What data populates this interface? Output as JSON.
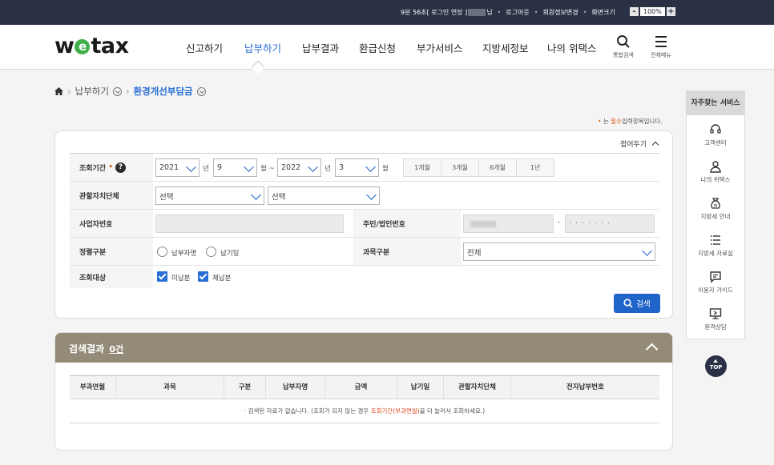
{
  "topbar": {
    "session_prefix": "9분 56초[ 로그인 연장 ]",
    "session_suffix": "님",
    "logout": "로그아웃",
    "member_edit": "회원정보변경",
    "screen_size": "화면크기",
    "zoom_minus": "-",
    "zoom_value": "100%",
    "zoom_plus": "+"
  },
  "header": {
    "logo_pre": "w",
    "logo_e": "e",
    "logo_post": "tax",
    "nav": [
      "신고하기",
      "납부하기",
      "납부결과",
      "환급신청",
      "부가서비스",
      "지방세정보",
      "나의 위택스"
    ],
    "active_nav": "납부하기",
    "search_label": "통합검색",
    "menu_label": "전체메뉴"
  },
  "breadcrumb": {
    "level1": "납부하기",
    "current": "환경개선부담금"
  },
  "note": {
    "bullet": "•",
    "prefix": "는",
    "required": "필수",
    "suffix": "입력항목입니다."
  },
  "form": {
    "collapse_label": "접어두기",
    "period_label": "조회기간",
    "period_required_mark": "•",
    "help_icon": "?",
    "from_year": "2021",
    "year_unit": "년",
    "from_month": "9",
    "month_tilde": "월 ~",
    "to_year": "2022",
    "to_month": "3",
    "month_unit": "월",
    "period_buttons": [
      "1개월",
      "3개월",
      "6개월",
      "1년"
    ],
    "authority_label": "관할자치단체",
    "authority_select1": "선택",
    "authority_select2": "선택",
    "bizno_label": "사업자번호",
    "idno_label": "주민/법인번호",
    "id_dash": "-",
    "id_back": "· · · · · · ·",
    "sort_label": "정렬구분",
    "sort_options": [
      "납부자명",
      "납기일"
    ],
    "tax_label": "과목구분",
    "tax_value": "전체",
    "target_label": "조회대상",
    "target_options": [
      "미납분",
      "체납분"
    ],
    "search_button": "검색"
  },
  "results": {
    "title": "검색결과",
    "count": "0건",
    "columns": [
      "부과연월",
      "과목",
      "구분",
      "납부자명",
      "금액",
      "납기일",
      "관할자치단체",
      "전자납부번호"
    ],
    "empty_pre": "· 검색된 자료가 없습니다. (조회가 되지 않는 경우 ",
    "empty_red": "조회기간(부과연월)",
    "empty_post": "을 더 늘려서 조회하세요.)"
  },
  "sidebar": {
    "title": "자주찾는 서비스",
    "items": [
      "고객센터",
      "나의 위택스",
      "지방세 안내",
      "지방세 자료실",
      "이용자 가이드",
      "원격상담"
    ]
  },
  "top_button": "TOP",
  "colors": {
    "accent": "#2a6fd6",
    "topbar": "#2a3145",
    "result_header": "#938b78",
    "required": "#e05a1f"
  }
}
